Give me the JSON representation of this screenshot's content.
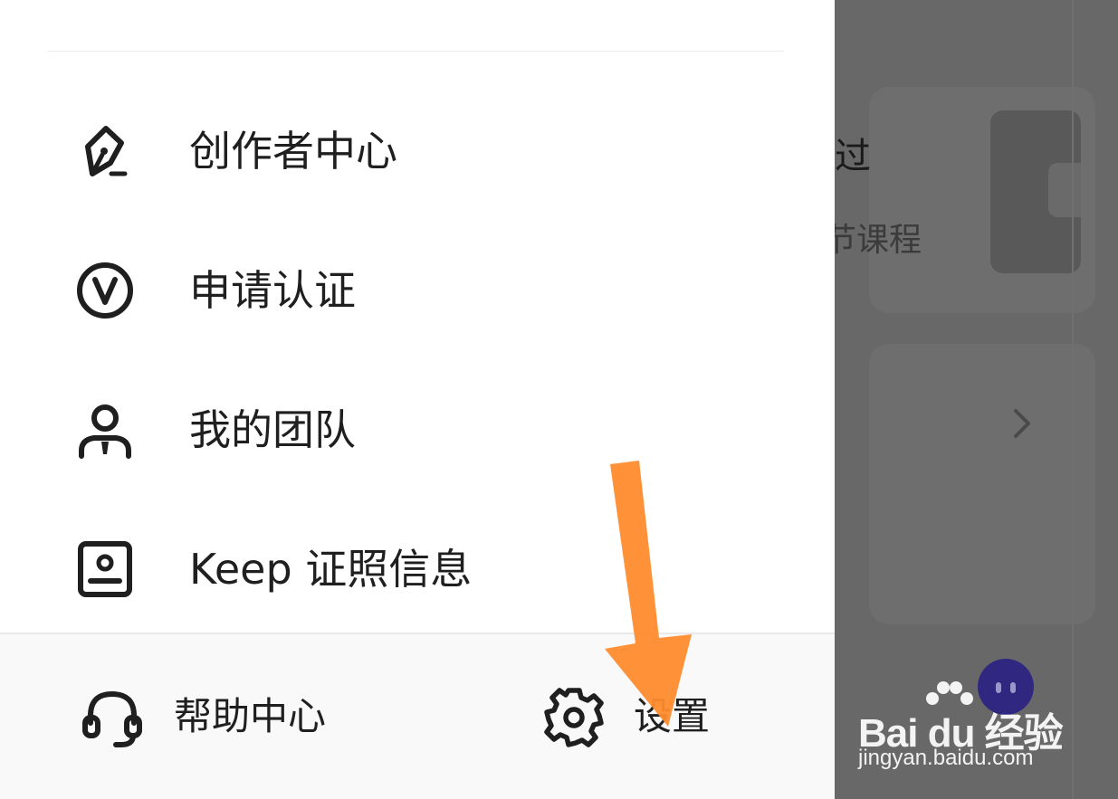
{
  "background": {
    "card_title_fragment": "过",
    "card_subtitle_fragment": "节课程",
    "chevron_icon": "chevron-right-icon"
  },
  "menu": {
    "items": [
      {
        "label": "创作者中心",
        "icon": "pen-nib-icon"
      },
      {
        "label": "申请认证",
        "icon": "verified-v-icon"
      },
      {
        "label": "我的团队",
        "icon": "team-person-icon"
      },
      {
        "label": "Keep 证照信息",
        "icon": "license-card-icon"
      }
    ]
  },
  "footer": {
    "help": {
      "label": "帮助中心",
      "icon": "headset-icon"
    },
    "settings": {
      "label": "设置",
      "icon": "gear-icon"
    }
  },
  "annotation": {
    "arrow_color": "#FF8C2E",
    "arrow_target": "settings"
  },
  "watermark": {
    "brand": "Bai du 经验",
    "url": "jingyan.baidu.com"
  },
  "colors": {
    "overlay": "#686868",
    "drawer_bg": "#FFFFFF",
    "footer_bg": "#F9F9F9",
    "text": "#1F1F1F",
    "bot_bg": "#2F2780"
  }
}
